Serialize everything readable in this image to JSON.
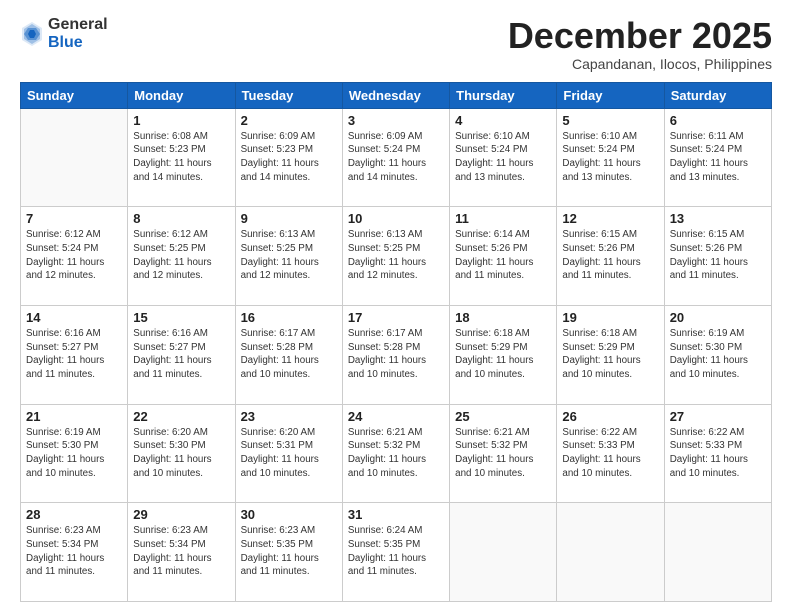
{
  "logo": {
    "general": "General",
    "blue": "Blue"
  },
  "header": {
    "month": "December 2025",
    "location": "Capandanan, Ilocos, Philippines"
  },
  "weekdays": [
    "Sunday",
    "Monday",
    "Tuesday",
    "Wednesday",
    "Thursday",
    "Friday",
    "Saturday"
  ],
  "weeks": [
    [
      {
        "day": "",
        "info": ""
      },
      {
        "day": "1",
        "info": "Sunrise: 6:08 AM\nSunset: 5:23 PM\nDaylight: 11 hours\nand 14 minutes."
      },
      {
        "day": "2",
        "info": "Sunrise: 6:09 AM\nSunset: 5:23 PM\nDaylight: 11 hours\nand 14 minutes."
      },
      {
        "day": "3",
        "info": "Sunrise: 6:09 AM\nSunset: 5:24 PM\nDaylight: 11 hours\nand 14 minutes."
      },
      {
        "day": "4",
        "info": "Sunrise: 6:10 AM\nSunset: 5:24 PM\nDaylight: 11 hours\nand 13 minutes."
      },
      {
        "day": "5",
        "info": "Sunrise: 6:10 AM\nSunset: 5:24 PM\nDaylight: 11 hours\nand 13 minutes."
      },
      {
        "day": "6",
        "info": "Sunrise: 6:11 AM\nSunset: 5:24 PM\nDaylight: 11 hours\nand 13 minutes."
      }
    ],
    [
      {
        "day": "7",
        "info": "Sunrise: 6:12 AM\nSunset: 5:24 PM\nDaylight: 11 hours\nand 12 minutes."
      },
      {
        "day": "8",
        "info": "Sunrise: 6:12 AM\nSunset: 5:25 PM\nDaylight: 11 hours\nand 12 minutes."
      },
      {
        "day": "9",
        "info": "Sunrise: 6:13 AM\nSunset: 5:25 PM\nDaylight: 11 hours\nand 12 minutes."
      },
      {
        "day": "10",
        "info": "Sunrise: 6:13 AM\nSunset: 5:25 PM\nDaylight: 11 hours\nand 12 minutes."
      },
      {
        "day": "11",
        "info": "Sunrise: 6:14 AM\nSunset: 5:26 PM\nDaylight: 11 hours\nand 11 minutes."
      },
      {
        "day": "12",
        "info": "Sunrise: 6:15 AM\nSunset: 5:26 PM\nDaylight: 11 hours\nand 11 minutes."
      },
      {
        "day": "13",
        "info": "Sunrise: 6:15 AM\nSunset: 5:26 PM\nDaylight: 11 hours\nand 11 minutes."
      }
    ],
    [
      {
        "day": "14",
        "info": "Sunrise: 6:16 AM\nSunset: 5:27 PM\nDaylight: 11 hours\nand 11 minutes."
      },
      {
        "day": "15",
        "info": "Sunrise: 6:16 AM\nSunset: 5:27 PM\nDaylight: 11 hours\nand 11 minutes."
      },
      {
        "day": "16",
        "info": "Sunrise: 6:17 AM\nSunset: 5:28 PM\nDaylight: 11 hours\nand 10 minutes."
      },
      {
        "day": "17",
        "info": "Sunrise: 6:17 AM\nSunset: 5:28 PM\nDaylight: 11 hours\nand 10 minutes."
      },
      {
        "day": "18",
        "info": "Sunrise: 6:18 AM\nSunset: 5:29 PM\nDaylight: 11 hours\nand 10 minutes."
      },
      {
        "day": "19",
        "info": "Sunrise: 6:18 AM\nSunset: 5:29 PM\nDaylight: 11 hours\nand 10 minutes."
      },
      {
        "day": "20",
        "info": "Sunrise: 6:19 AM\nSunset: 5:30 PM\nDaylight: 11 hours\nand 10 minutes."
      }
    ],
    [
      {
        "day": "21",
        "info": "Sunrise: 6:19 AM\nSunset: 5:30 PM\nDaylight: 11 hours\nand 10 minutes."
      },
      {
        "day": "22",
        "info": "Sunrise: 6:20 AM\nSunset: 5:30 PM\nDaylight: 11 hours\nand 10 minutes."
      },
      {
        "day": "23",
        "info": "Sunrise: 6:20 AM\nSunset: 5:31 PM\nDaylight: 11 hours\nand 10 minutes."
      },
      {
        "day": "24",
        "info": "Sunrise: 6:21 AM\nSunset: 5:32 PM\nDaylight: 11 hours\nand 10 minutes."
      },
      {
        "day": "25",
        "info": "Sunrise: 6:21 AM\nSunset: 5:32 PM\nDaylight: 11 hours\nand 10 minutes."
      },
      {
        "day": "26",
        "info": "Sunrise: 6:22 AM\nSunset: 5:33 PM\nDaylight: 11 hours\nand 10 minutes."
      },
      {
        "day": "27",
        "info": "Sunrise: 6:22 AM\nSunset: 5:33 PM\nDaylight: 11 hours\nand 10 minutes."
      }
    ],
    [
      {
        "day": "28",
        "info": "Sunrise: 6:23 AM\nSunset: 5:34 PM\nDaylight: 11 hours\nand 11 minutes."
      },
      {
        "day": "29",
        "info": "Sunrise: 6:23 AM\nSunset: 5:34 PM\nDaylight: 11 hours\nand 11 minutes."
      },
      {
        "day": "30",
        "info": "Sunrise: 6:23 AM\nSunset: 5:35 PM\nDaylight: 11 hours\nand 11 minutes."
      },
      {
        "day": "31",
        "info": "Sunrise: 6:24 AM\nSunset: 5:35 PM\nDaylight: 11 hours\nand 11 minutes."
      },
      {
        "day": "",
        "info": ""
      },
      {
        "day": "",
        "info": ""
      },
      {
        "day": "",
        "info": ""
      }
    ]
  ]
}
